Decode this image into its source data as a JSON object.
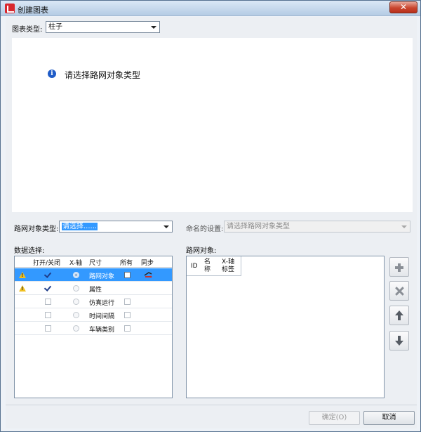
{
  "window": {
    "title": "创建图表",
    "close_label": "✕"
  },
  "chart_type": {
    "label": "图表类型:",
    "value": "柱子"
  },
  "preview": {
    "hint": "请选择路网对象类型"
  },
  "object_type": {
    "label": "路网对象类型:",
    "value": "请选择......"
  },
  "naming": {
    "label": "命名的设置:",
    "value": "请选择路网对象类型"
  },
  "data_selection": {
    "label": "数据选择:",
    "columns": [
      "打开/关闭",
      "X-轴",
      "尺寸",
      "所有",
      "同步"
    ],
    "rows": [
      {
        "warning": true,
        "checked": true,
        "checkbox": false,
        "label": "路网对象",
        "all": true,
        "sync": true,
        "selected": true
      },
      {
        "warning": true,
        "checked": true,
        "checkbox": false,
        "label": "属性",
        "all": false,
        "sync": false,
        "selected": false
      },
      {
        "warning": false,
        "checked": false,
        "checkbox": true,
        "label": "仿真运行",
        "all": true,
        "sync": false,
        "selected": false
      },
      {
        "warning": false,
        "checked": false,
        "checkbox": true,
        "label": "时间间隔",
        "all": true,
        "sync": false,
        "selected": false
      },
      {
        "warning": false,
        "checked": false,
        "checkbox": true,
        "label": "车辆类别",
        "all": true,
        "sync": false,
        "selected": false
      }
    ]
  },
  "network_objects": {
    "label": "路网对象:",
    "columns": {
      "id": "ID",
      "name_1": "名",
      "name_2": "称",
      "xaxis_1": "X-轴",
      "xaxis_2": "标签"
    }
  },
  "side_buttons": {
    "add": "plus-icon",
    "remove": "x-icon",
    "up": "arrow-up-icon",
    "down": "arrow-down-icon"
  },
  "footer": {
    "ok_label": "确定(O)",
    "cancel_label": "取消"
  },
  "colors": {
    "selection": "#3399ff",
    "close": "#c9452e",
    "info": "#1f5cc7",
    "warning": "#f0c020"
  }
}
